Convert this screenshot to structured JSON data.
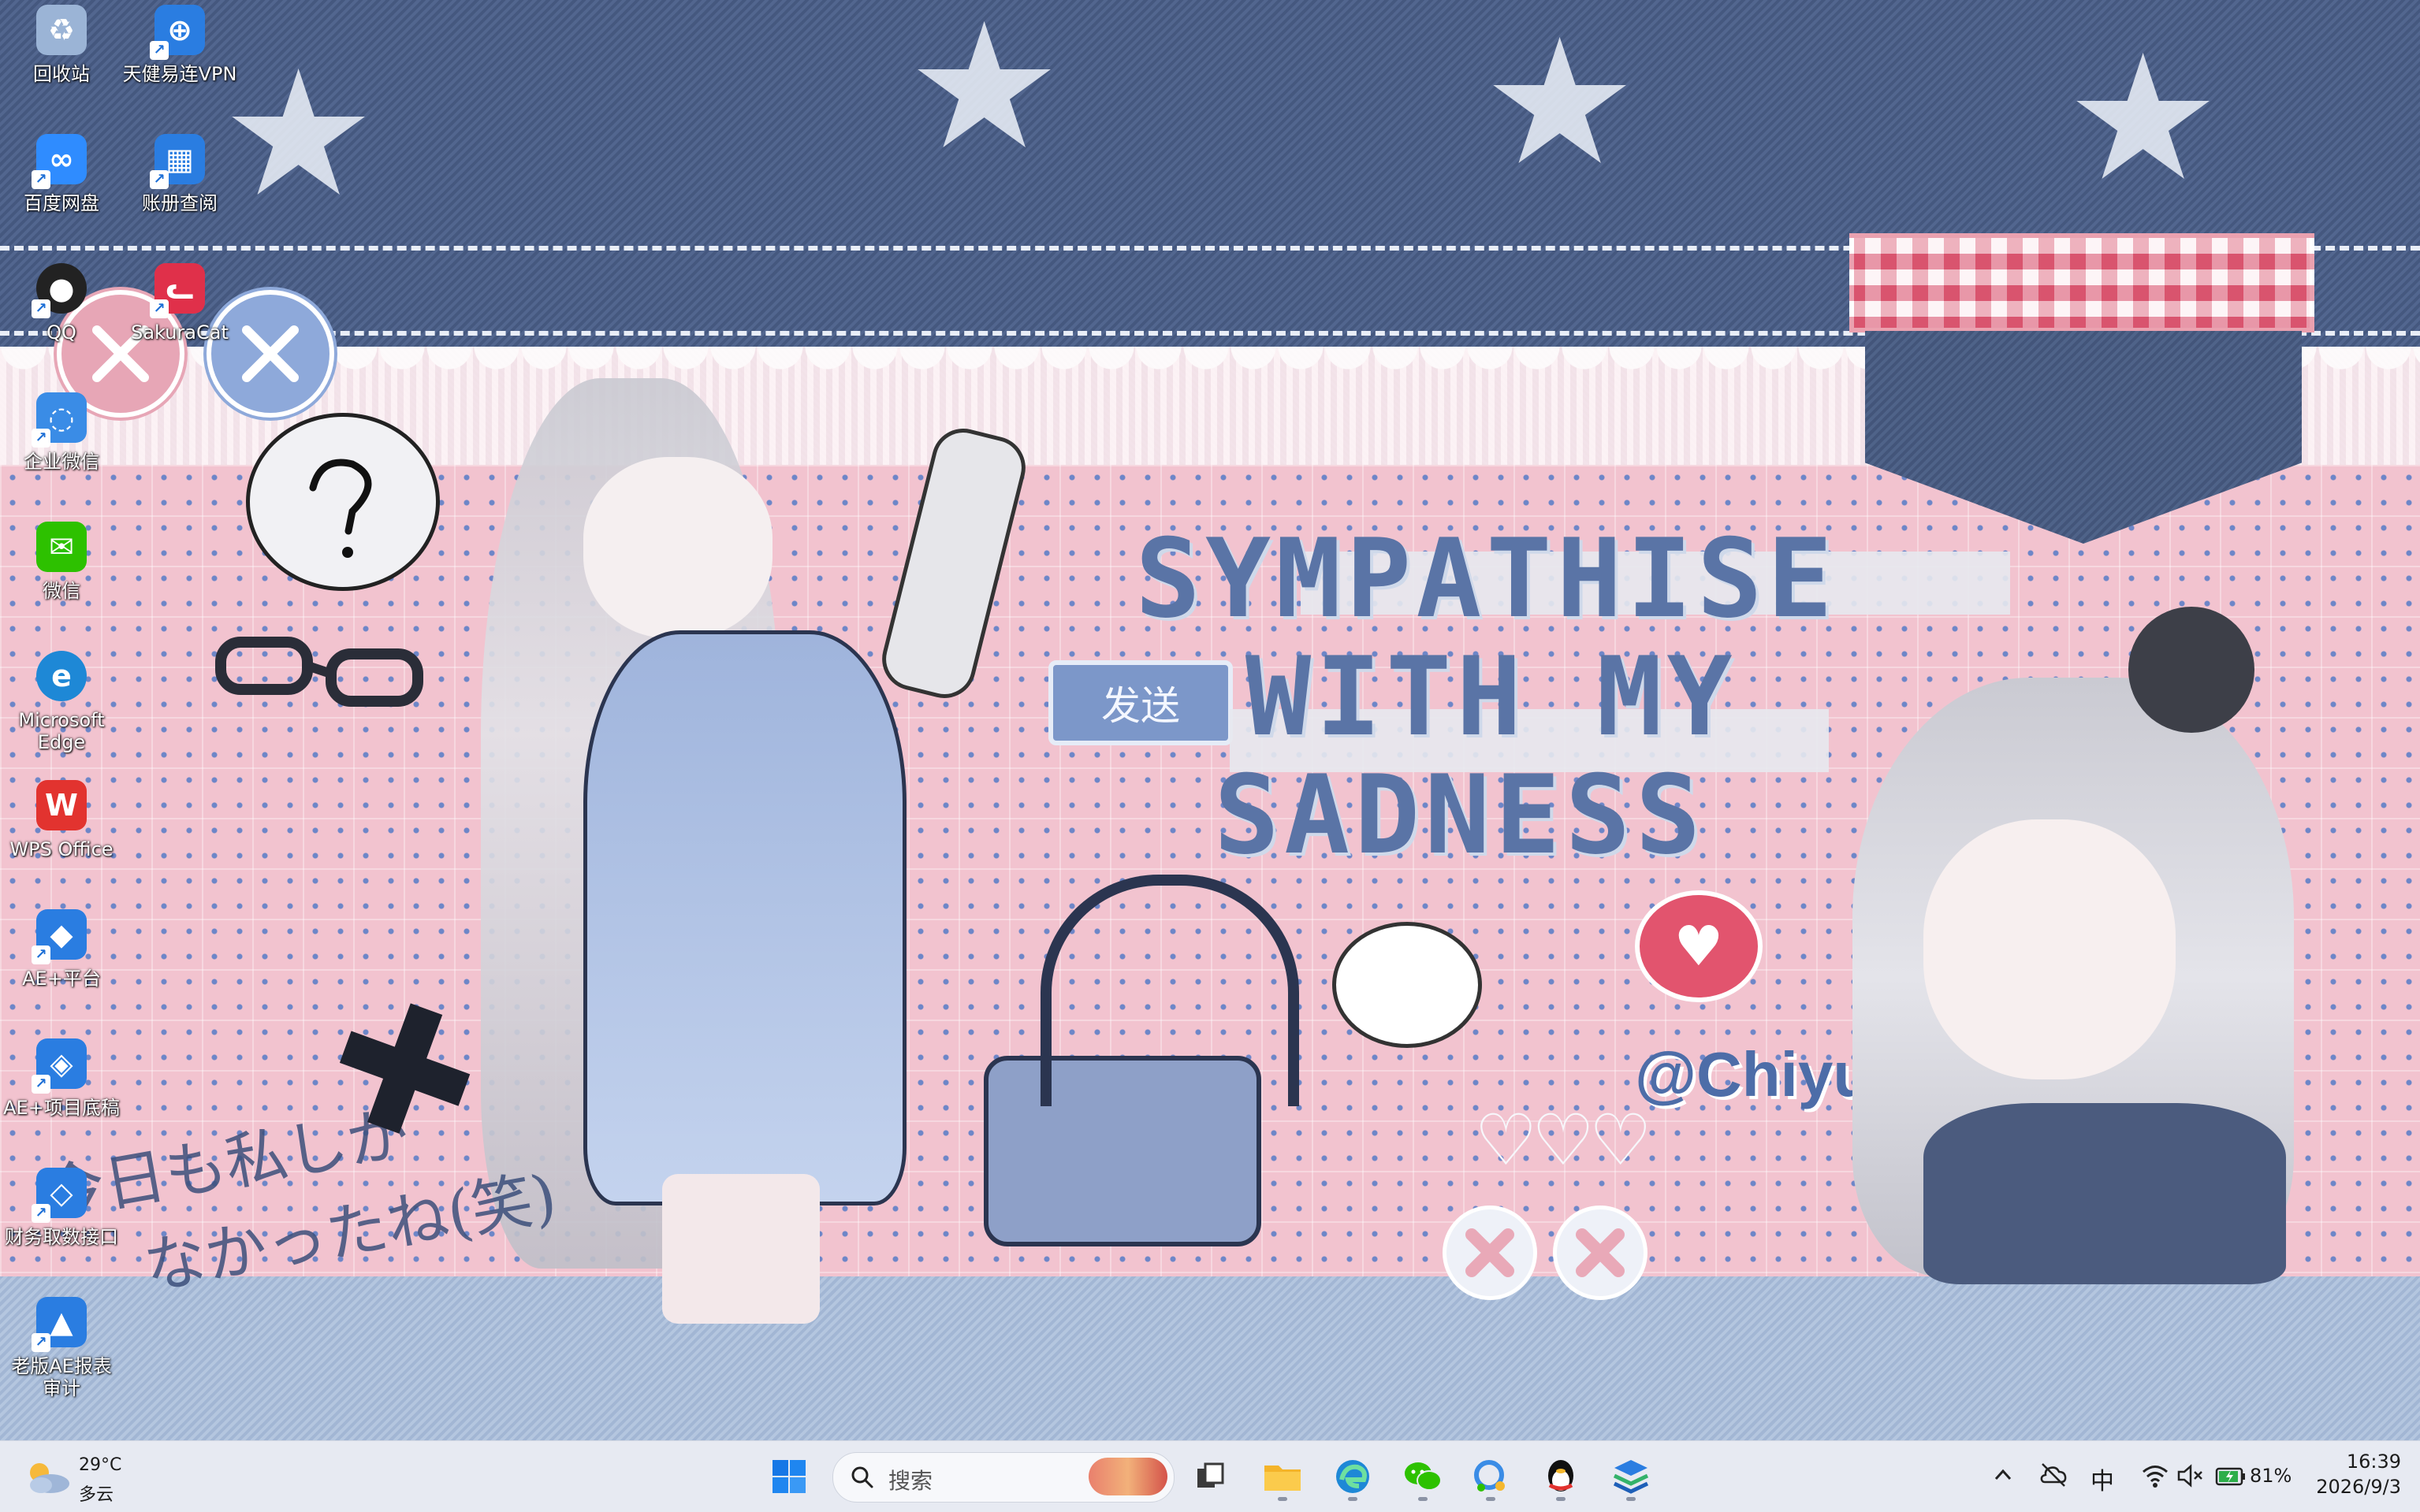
{
  "wallpaper": {
    "title_lines": [
      "SYMPATHISE",
      "WITH MY",
      "SADNESS"
    ],
    "handle": "@Chiyu",
    "send_button": "发送",
    "jp_line1": "今日も私しか",
    "jp_line2": "なかったね(笑)",
    "colors": {
      "denim": "#4b5f86",
      "pink": "#f2c3cf",
      "title": "#5a74a6"
    }
  },
  "desktop_icons": [
    {
      "label": "回收站",
      "icon": "recycle-bin-icon",
      "color": "#9bb4d6"
    },
    {
      "label": "天健易连VPN",
      "icon": "vpn-icon",
      "color": "#2a7de1"
    },
    {
      "label": "百度网盘",
      "icon": "baidu-netdisk-icon",
      "color": "#2f8cff"
    },
    {
      "label": "账册查阅",
      "icon": "ledger-icon",
      "color": "#2a7de1"
    },
    {
      "label": "QQ",
      "icon": "qq-penguin-icon",
      "color": "#222222"
    },
    {
      "label": "SakuraCat",
      "icon": "sakuracat-icon",
      "color": "#e0304a"
    },
    {
      "label": "企业微信",
      "icon": "wecom-icon",
      "color": "#3a8ce6"
    },
    {
      "label": "微信",
      "icon": "wechat-icon",
      "color": "#2dc100"
    },
    {
      "label": "Microsoft Edge",
      "icon": "edge-icon",
      "color": "#1e88d6"
    },
    {
      "label": "WPS Office",
      "icon": "wps-icon",
      "color": "#e2332f"
    },
    {
      "label": "AE+平台",
      "icon": "ae-platform-icon",
      "color": "#2a7de1"
    },
    {
      "label": "AE+项目底稿",
      "icon": "ae-project-icon",
      "color": "#2a7de1"
    },
    {
      "label": "财务取数接口",
      "icon": "finance-data-icon",
      "color": "#2a7de1"
    },
    {
      "label": "老版AE报表审计",
      "icon": "ae-report-icon",
      "color": "#2a7de1"
    }
  ],
  "taskbar": {
    "weather_temp": "29°C",
    "weather_desc": "多云",
    "search_placeholder": "搜索",
    "apps": [
      {
        "name": "start",
        "icon": "windows-start-icon"
      },
      {
        "name": "task-view",
        "icon": "task-view-icon"
      },
      {
        "name": "file-explorer",
        "icon": "folder-icon"
      },
      {
        "name": "edge",
        "icon": "edge-icon"
      },
      {
        "name": "wechat",
        "icon": "wechat-icon"
      },
      {
        "name": "wecom",
        "icon": "wecom-icon"
      },
      {
        "name": "qq",
        "icon": "qq-penguin-icon"
      },
      {
        "name": "stack-app",
        "icon": "layers-icon"
      }
    ],
    "tray": {
      "ime": "中",
      "battery": "81%",
      "time": "16:39",
      "date": "2026/9/3"
    }
  }
}
